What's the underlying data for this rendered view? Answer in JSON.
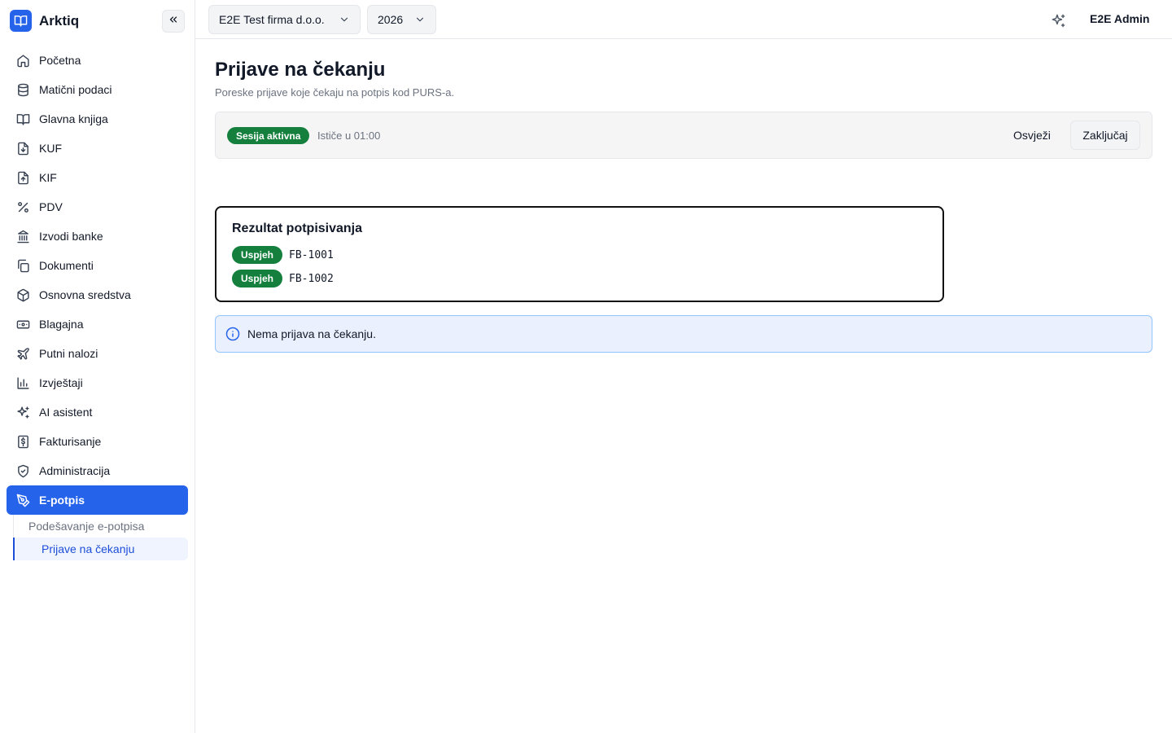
{
  "brand": {
    "name": "Arktiq",
    "accent": "#2563eb"
  },
  "sidebar": {
    "collapse_icon": "chevrons-left-icon",
    "items": [
      {
        "label": "Početna",
        "icon": "home-icon"
      },
      {
        "label": "Matični podaci",
        "icon": "database-icon"
      },
      {
        "label": "Glavna knjiga",
        "icon": "book-open-icon"
      },
      {
        "label": "KUF",
        "icon": "file-download-icon"
      },
      {
        "label": "KIF",
        "icon": "file-upload-icon"
      },
      {
        "label": "PDV",
        "icon": "percent-icon"
      },
      {
        "label": "Izvodi banke",
        "icon": "bank-icon"
      },
      {
        "label": "Dokumenti",
        "icon": "copy-icon"
      },
      {
        "label": "Osnovna sredstva",
        "icon": "package-icon"
      },
      {
        "label": "Blagajna",
        "icon": "banknote-icon"
      },
      {
        "label": "Putni nalozi",
        "icon": "plane-icon"
      },
      {
        "label": "Izvještaji",
        "icon": "bar-chart-icon"
      },
      {
        "label": "AI asistent",
        "icon": "sparkles-icon"
      },
      {
        "label": "Fakturisanje",
        "icon": "receipt-icon"
      },
      {
        "label": "Administracija",
        "icon": "shield-icon"
      },
      {
        "label": "E-potpis",
        "icon": "pen-icon",
        "active": true
      }
    ],
    "subitems": [
      {
        "label": "Podešavanje e-potpisa"
      },
      {
        "label": "Prijave na čekanju",
        "current": true
      }
    ]
  },
  "topbar": {
    "company": "E2E Test firma d.o.o.",
    "year": "2026",
    "user": "E2E Admin"
  },
  "page": {
    "title": "Prijave na čekanju",
    "subtitle": "Poreske prijave koje čekaju na potpis kod PURS-a."
  },
  "session": {
    "badge": "Sesija aktivna",
    "expires": "Ističe u 01:00",
    "refresh_label": "Osvježi",
    "lock_label": "Zaključaj"
  },
  "result": {
    "title": "Rezultat potpisivanja",
    "rows": [
      {
        "status": "Uspjeh",
        "code": "FB-1001"
      },
      {
        "status": "Uspjeh",
        "code": "FB-1002"
      }
    ]
  },
  "alert": {
    "text": "Nema prijava na čekanju."
  },
  "colors": {
    "success": "#15803d",
    "info_bg": "#eaf0fd",
    "info_border": "#93c5fd"
  }
}
